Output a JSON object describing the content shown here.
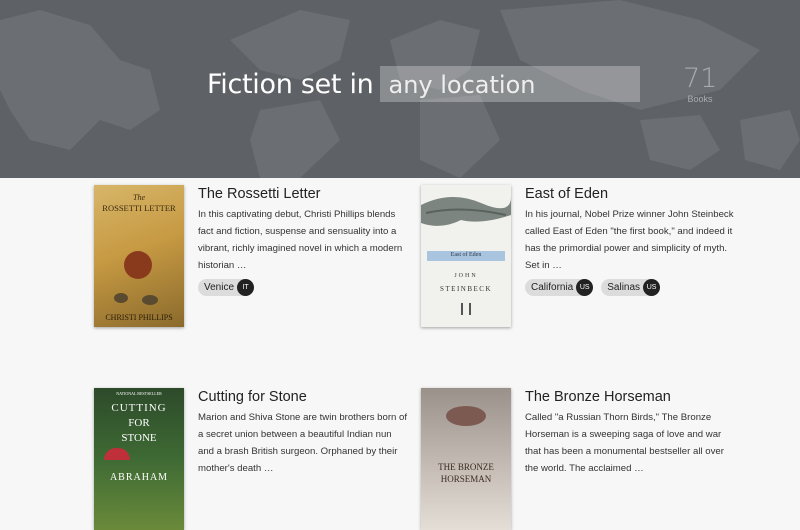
{
  "header": {
    "prefix": "Fiction set in",
    "search_placeholder": "any location",
    "count": "71",
    "count_label": "Books"
  },
  "books": [
    {
      "title": "The Rossetti Letter",
      "description": "In this captivating debut, Christi Phillips blends fact and fiction, suspense and sensuality into a vibrant, richly imagined novel in which a modern historian …",
      "cover": {
        "line1": "The",
        "line2": "ROSSETTI LETTER",
        "author": "CHRISTI PHILLIPS"
      },
      "tags": [
        {
          "label": "Venice",
          "cc": "IT"
        }
      ]
    },
    {
      "title": "East of Eden",
      "description": "In his journal, Nobel Prize winner John Steinbeck called East of Eden \"the first book,\" and indeed it has the primordial power and simplicity of myth. Set in …",
      "cover": {
        "line1": "East of Eden",
        "line2": "JOHN",
        "author": "STEINBECK"
      },
      "tags": [
        {
          "label": "California",
          "cc": "US"
        },
        {
          "label": "Salinas",
          "cc": "US"
        }
      ]
    },
    {
      "title": "Cutting for Stone",
      "description": "Marion and Shiva Stone are twin brothers born of a secret union between a beautiful Indian nun and a brash British surgeon. Orphaned by their mother's death …",
      "cover": {
        "line1": "NATIONAL BESTSELLER",
        "line2": "CUTTING",
        "line3": "FOR",
        "line4": "STONE",
        "author": "ABRAHAM"
      },
      "tags": []
    },
    {
      "title": "The Bronze Horseman",
      "description": "Called \"a Russian Thorn Birds,\" The Bronze Horseman is a sweeping saga of love and war that has been a monumental bestseller all over the world. The acclaimed …",
      "cover": {
        "line1": "THE BRONZE",
        "line2": "HORSEMAN"
      },
      "tags": []
    }
  ],
  "colors": {
    "header_bg": "#5e6165",
    "tag_bg": "#dcdcdc",
    "badge_bg": "#222222"
  }
}
